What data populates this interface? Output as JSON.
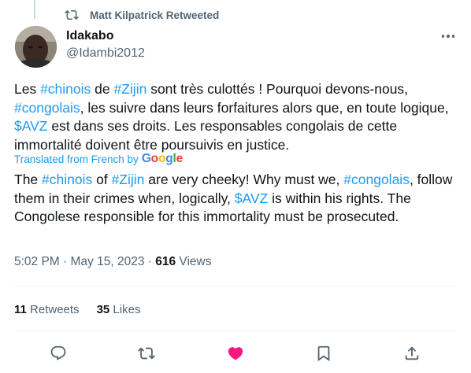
{
  "retweet_banner": {
    "text": "Matt Kilpatrick Retweeted"
  },
  "author": {
    "name": "Idakabo",
    "handle": "@Idambi2012"
  },
  "tweet": {
    "original": {
      "t1": "Les ",
      "h1": "#chinois",
      "t2": " de ",
      "h2": "#Zijin",
      "t3": " sont très culottés ! Pourquoi devons-nous, ",
      "h3": "#congolais",
      "t4": ", les suivre dans leurs forfaitures alors que, en toute logique, ",
      "h4": "$AVZ",
      "t5": " est dans ses droits. Les responsables congolais de cette immortalité doivent être poursuivis en justice."
    },
    "translated_label": "Translated from French by",
    "translation_provider": "Google",
    "translation": {
      "t1": "The ",
      "h1": "#chinois",
      "t2": " of ",
      "h2": "#Zijin",
      "t3": " are very cheeky! Why must we, ",
      "h3": "#congolais",
      "t4": ", follow them in their crimes when, logically, ",
      "h4": "$AVZ",
      "t5": " is within his rights. The Congolese responsible for this immortality must be prosecuted."
    }
  },
  "meta": {
    "time": "5:02 PM",
    "date": "May 15, 2023",
    "views_count": "616",
    "views_label": "Views"
  },
  "stats": {
    "retweets_count": "11",
    "retweets_label": "Retweets",
    "likes_count": "35",
    "likes_label": "Likes"
  },
  "actions": [
    {
      "icon": "reply-icon"
    },
    {
      "icon": "retweet-icon"
    },
    {
      "icon": "like-icon",
      "active_color": "#f91880"
    },
    {
      "icon": "bookmark-icon"
    },
    {
      "icon": "share-icon"
    }
  ],
  "colors": {
    "link": "#1d9bf0",
    "secondary": "#536471",
    "text": "#0f1419",
    "like": "#f91880"
  }
}
